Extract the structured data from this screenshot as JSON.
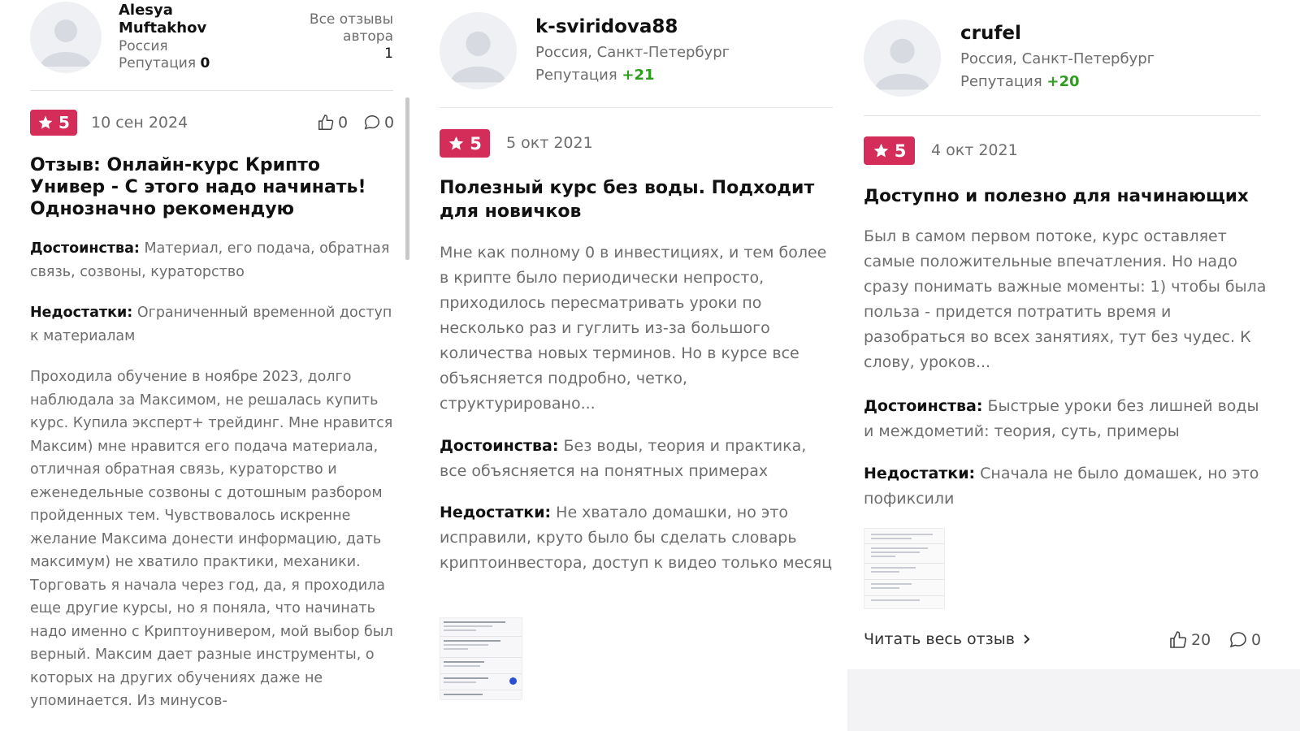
{
  "reviews": [
    {
      "author": "Alesya Muftakhov",
      "author_line1": "Alesya",
      "author_line2": "Muftakhov",
      "location": "Россия",
      "reputation_label": "Репутация",
      "reputation_value": "0",
      "all_reviews_label_1": "Все отзывы",
      "all_reviews_label_2": "автора",
      "all_reviews_count": "1",
      "rating": "5",
      "date": "10 сен 2024",
      "likes": "0",
      "comments": "0",
      "title": "Отзыв: Онлайн-курс Крипто Универ - С этого надо начинать! Однозначно рекомендую",
      "pros_label": "Достоинства:",
      "pros": "Материал, его подача, обратная связь, созвоны, кураторство",
      "cons_label": "Недостатки:",
      "cons": "Ограниченный временной доступ к материалам",
      "body": "Проходила обучение в ноябре 2023, долго наблюдала за Максимом, не решалась купить курс. Купила эксперт+ трейдинг. Мне нравится Максим) мне нравится его подача материала, отличная обратная связь, кураторство и еженедельные созвоны с дотошным разбором пройденных тем. Чувствовалось искренне желание Максима донести информацию, дать максимум) не хватило практики, механики. Торговать я начала через год, да, я проходила еще другие курсы, но я поняла, что начинать надо именно с Криптоунивером, мой выбор был верный. Максим дает разные инструменты, о которых на других обучениях даже не упоминается. Из минусов-"
    },
    {
      "author": "k-sviridova88",
      "location": "Россия, Санкт-Петербург",
      "reputation_label": "Репутация",
      "reputation_value": "+21",
      "rating": "5",
      "date": "5 окт 2021",
      "title": "Полезный курс без воды. Подходит для новичков",
      "body": "Мне как полному 0 в инвестициях, и тем более в крипте было периодически непросто, приходилось пересматривать уроки по несколько раз и гуглить из-за большого количества новых терминов. Но в курсе все объясняется подробно, четко, структурировано...",
      "pros_label": "Достоинства:",
      "pros": "Без воды, теория и практика, все объясняется на понятных примерах",
      "cons_label": "Недостатки:",
      "cons": "Не хватало домашки, но это исправили, круто было бы сделать словарь криптоинвестора, доступ к видео только месяц"
    },
    {
      "author": "crufel",
      "location": "Россия, Санкт-Петербург",
      "reputation_label": "Репутация",
      "reputation_value": "+20",
      "rating": "5",
      "date": "4 окт 2021",
      "title": "Доступно и полезно для начинающих",
      "body": "Был в самом первом потоке, курс оставляет самые положительные впечатления. Но надо сразу понимать важные моменты: 1) чтобы была польза - придется потратить время и разобраться во всех занятиях, тут без чудес. К слову, уроков...",
      "pros_label": "Достоинства:",
      "pros": "Быстрые уроки без лишней воды и междометий: теория, суть, примеры",
      "cons_label": "Недостатки:",
      "cons": "Сначала не было домашек, но это пофиксили",
      "read_more": "Читать весь отзыв",
      "likes": "20",
      "comments": "0"
    }
  ],
  "icons": {
    "star": "star-icon",
    "like": "thumbs-up-icon",
    "comment": "comment-bubble-icon",
    "avatar": "user-avatar-placeholder",
    "chevron": "chevron-right-icon"
  },
  "colors": {
    "badge": "#d42d59",
    "reputation_positive": "#2e9d1d",
    "muted_text": "#6d6d6d"
  }
}
